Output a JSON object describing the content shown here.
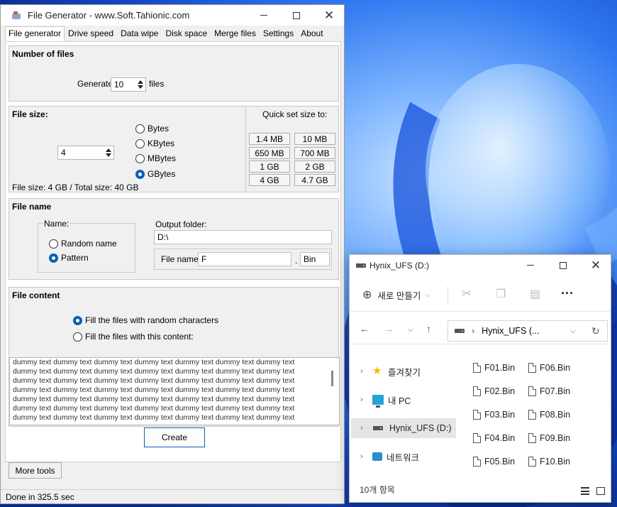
{
  "file_generator": {
    "title": "File Generator  -  www.Soft.Tahionic.com",
    "tabs": [
      "File generator",
      "Drive speed",
      "Data wipe",
      "Disk space",
      "Merge files",
      "Settings",
      "About"
    ],
    "number_of_files": {
      "heading": "Number of files",
      "generate_label": "Generate",
      "count": "10",
      "files_label": "files"
    },
    "file_size": {
      "heading": "File size:",
      "value": "4",
      "units": [
        "Bytes",
        "KBytes",
        "MBytes",
        "GBytes"
      ],
      "selected_unit": "GBytes",
      "summary": "File size: 4 GB / Total size: 40 GB",
      "quick_set_label": "Quick set size to:",
      "quick_sizes": [
        "1.4 MB",
        "10 MB",
        "650 MB",
        "700 MB",
        "1 GB",
        "2 GB",
        "4 GB",
        "4.7 GB"
      ]
    },
    "file_name": {
      "heading": "File name",
      "name_label": "Name:",
      "options": [
        "Random name",
        "Pattern"
      ],
      "selected": "Pattern",
      "output_folder_label": "Output folder:",
      "output_folder": "D:\\",
      "file_name_label": "File name:",
      "file_name_value": "F",
      "dot": ".",
      "extension": "Bin"
    },
    "file_content": {
      "heading": "File content",
      "options": [
        "Fill the files with random characters",
        "Fill the files with this content:"
      ],
      "selected": "Fill the files with random characters",
      "text_lines": [
        "dummy text dummy text dummy text dummy text dummy text dummy text dummy text",
        "dummy text dummy text dummy text dummy text dummy text dummy text dummy text",
        "dummy text dummy text dummy text dummy text dummy text dummy text dummy text",
        "dummy text dummy text dummy text dummy text dummy text dummy text dummy text",
        "dummy text dummy text dummy text dummy text dummy text dummy text dummy text",
        "dummy text dummy text dummy text dummy text dummy text dummy text dummy text",
        "dummy text dummy text dummy text dummy text dummy text dummy text dummy text"
      ]
    },
    "create_label": "Create",
    "more_tools_label": "More tools",
    "status": "Done in 325.5 sec",
    "accent_color": "#0b5fb8"
  },
  "explorer": {
    "title": "Hynix_UFS (D:)",
    "new_label": "새로 만들기",
    "address": "Hynix_UFS (...",
    "sidebar": [
      "즐겨찾기",
      "내 PC",
      "Hynix_UFS (D:)",
      "네트워크"
    ],
    "sidebar_icons": [
      "star-icon",
      "pc-icon",
      "drive-icon",
      "network-icon"
    ],
    "files_col1": [
      "F01.Bin",
      "F02.Bin",
      "F03.Bin",
      "F04.Bin",
      "F05.Bin"
    ],
    "files_col2": [
      "F06.Bin",
      "F07.Bin",
      "F08.Bin",
      "F09.Bin",
      "F10.Bin"
    ],
    "status": "10개 항목"
  }
}
